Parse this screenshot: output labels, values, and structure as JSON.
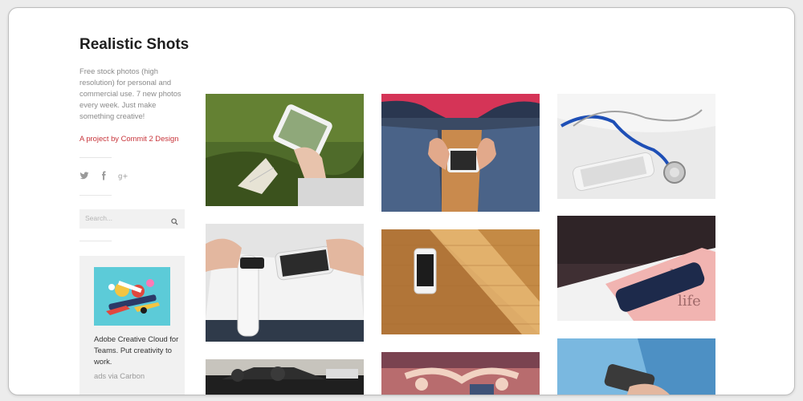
{
  "site": {
    "title": "Realistic Shots",
    "description": "Free stock photos (high resolution) for personal and commercial use. 7 new photos every week. Just make something creative!",
    "credit": "A project by Commit 2 Design"
  },
  "social": [
    "twitter-icon",
    "facebook-icon",
    "google-plus-icon"
  ],
  "search": {
    "placeholder": "Search...",
    "icon": "search-icon"
  },
  "ad": {
    "text": "Adobe Creative Cloud for Teams. Put creativity to work.",
    "via": "ads via Carbon"
  },
  "photos": [
    "phone-on-grass",
    "phone-in-lap-jeans",
    "stethoscope-and-phone",
    "smartwatch-and-phone",
    "phone-on-wood",
    "phone-on-book",
    "car-roof",
    "stretching-people",
    "hand-holding-phone"
  ],
  "colors": {
    "accent": "#c8353b",
    "title": "#1e1e1e",
    "muted": "#8a8a8a",
    "panel": "#f1f1f1"
  }
}
